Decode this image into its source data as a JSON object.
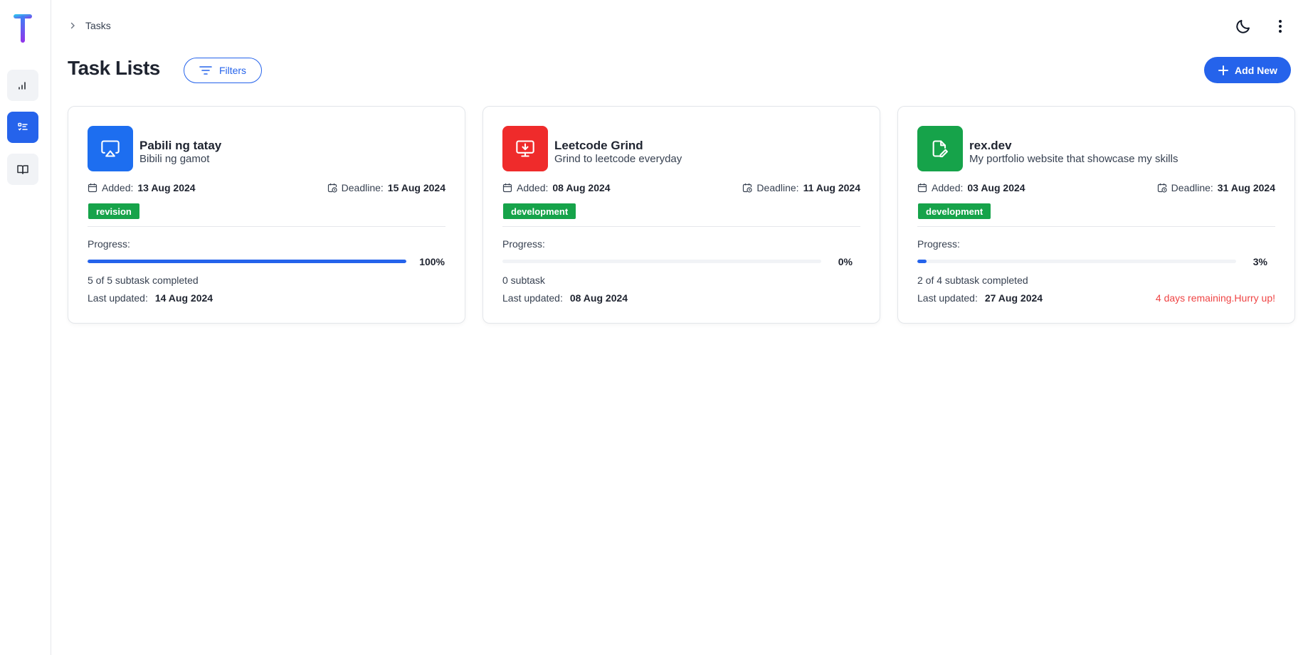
{
  "breadcrumb": {
    "label": "Tasks"
  },
  "page": {
    "title": "Task Lists"
  },
  "toolbar": {
    "filters_label": "Filters",
    "add_label": "Add New"
  },
  "sidebar": {
    "items": [
      {
        "name": "chart-icon"
      },
      {
        "name": "checklist-icon",
        "active": true
      },
      {
        "name": "book-icon"
      }
    ]
  },
  "cards": [
    {
      "title": "Pabili ng tatay",
      "subtitle": "Bibili ng gamot",
      "icon": "airplay-icon",
      "icon_color": "#1d6ef0",
      "added_label": "Added:",
      "added": "13 Aug 2024",
      "deadline_label": "Deadline:",
      "deadline": "15 Aug 2024",
      "tag": "revision",
      "progress_label": "Progress:",
      "progress_pct": "100%",
      "progress_value": 1.0,
      "subtasks": "5 of 5 subtask completed",
      "updated_label": "Last updated:",
      "updated": "14 Aug 2024",
      "warning": ""
    },
    {
      "title": "Leetcode Grind",
      "subtitle": "Grind to leetcode everyday",
      "icon": "monitor-download-icon",
      "icon_color": "#ef2b2b",
      "added_label": "Added:",
      "added": "08 Aug 2024",
      "deadline_label": "Deadline:",
      "deadline": "11 Aug 2024",
      "tag": "development",
      "progress_label": "Progress:",
      "progress_pct": "0%",
      "progress_value": 0.0,
      "subtasks": "0 subtask",
      "updated_label": "Last updated:",
      "updated": "08 Aug 2024",
      "warning": ""
    },
    {
      "title": "rex.dev",
      "subtitle": "My portfolio website that showcase my skills",
      "icon": "file-edit-icon",
      "icon_color": "#16a34a",
      "added_label": "Added:",
      "added": "03 Aug 2024",
      "deadline_label": "Deadline:",
      "deadline": "31 Aug 2024",
      "tag": "development",
      "progress_label": "Progress:",
      "progress_pct": "3%",
      "progress_value": 0.03,
      "subtasks": "2 of 4 subtask completed",
      "updated_label": "Last updated:",
      "updated": "27 Aug 2024",
      "warning": "4 days remaining.Hurry up!"
    }
  ]
}
